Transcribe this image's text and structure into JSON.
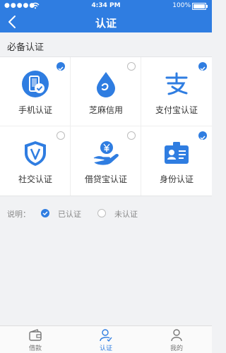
{
  "status_bar": {
    "carrier": "●●●●●",
    "time": "4:34 PM",
    "battery": "100%"
  },
  "nav": {
    "title": "认证"
  },
  "section": {
    "title": "必备认证"
  },
  "cards": [
    {
      "label": "手机认证",
      "checked": true,
      "icon": "phone-verified-icon"
    },
    {
      "label": "芝麻信用",
      "checked": false,
      "icon": "sesame-drop-icon"
    },
    {
      "label": "支付宝认证",
      "checked": true,
      "icon": "alipay-icon"
    },
    {
      "label": "社交认证",
      "checked": false,
      "icon": "shield-v-icon"
    },
    {
      "label": "借贷宝认证",
      "checked": false,
      "icon": "hand-yen-icon"
    },
    {
      "label": "身份认证",
      "checked": true,
      "icon": "id-card-icon"
    }
  ],
  "legend": {
    "prefix": "说明：",
    "verified": "已认证",
    "unverified": "未认证"
  },
  "tabs": [
    {
      "label": "借款",
      "icon": "wallet-icon",
      "active": false
    },
    {
      "label": "认证",
      "icon": "user-check-icon",
      "active": true
    },
    {
      "label": "我的",
      "icon": "person-icon",
      "active": false
    }
  ],
  "colors": {
    "accent": "#2f7de1",
    "unchecked": "#bdbdbd",
    "background": "#f1f2f4"
  }
}
